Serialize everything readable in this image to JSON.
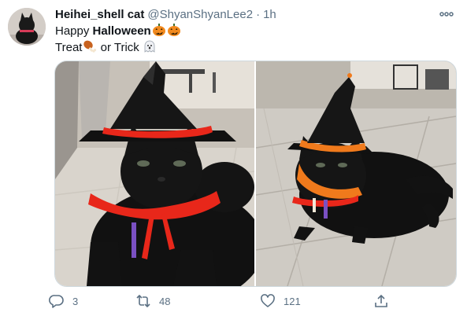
{
  "tweet": {
    "display_name": "Heihei_shell cat",
    "handle": "@ShyanShyanLee2",
    "separator": "·",
    "time": "1h",
    "text_line1_prefix": "Happy ",
    "text_line1_bold": "Halloween",
    "text_line2_a": "Treat",
    "text_line2_b": " or Trick",
    "emojis": [
      "jack-o-lantern",
      "jack-o-lantern",
      "poultry-leg",
      "ghost"
    ]
  },
  "actions": {
    "reply_count": "3",
    "retweet_count": "48",
    "like_count": "121"
  },
  "colors": {
    "text": "#0f1419",
    "secondary": "#5b7083",
    "border": "#cfd9de",
    "pumpkin": "#f28a1e",
    "collar_red": "#e8271a"
  },
  "icons": [
    "more-icon",
    "reply-icon",
    "retweet-icon",
    "like-icon",
    "share-icon"
  ]
}
